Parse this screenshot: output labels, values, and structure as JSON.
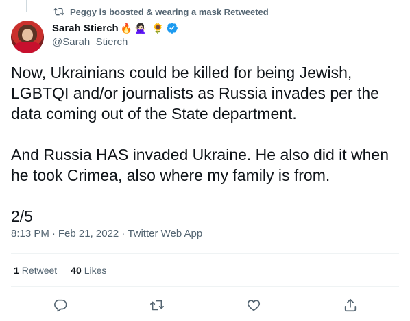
{
  "retweet_context": {
    "icon": "retweet-icon",
    "text": "Peggy is boosted & wearing a mask Retweeted"
  },
  "author": {
    "display_name": "Sarah Stierch",
    "emojis": [
      "🔥",
      "🙅🏻‍♀️",
      "🌻"
    ],
    "verified": true,
    "handle": "@Sarah_Stierch"
  },
  "tweet": {
    "text": "Now, Ukrainians could be killed for being Jewish, LGBTQI and/or journalists as Russia invades per the data coming out of the State department.\n\nAnd Russia HAS invaded Ukraine. He also did it when he took Crimea, also where my family is from.\n\n2/5"
  },
  "meta": {
    "time": "8:13 PM",
    "separator": "·",
    "date": "Feb 21, 2022",
    "source": "Twitter Web App"
  },
  "stats": {
    "retweets_count": "1",
    "retweets_label": "Retweet",
    "likes_count": "40",
    "likes_label": "Likes"
  },
  "actions": [
    "reply-icon",
    "retweet-icon",
    "like-icon",
    "share-icon"
  ],
  "colors": {
    "text_primary": "#0f1419",
    "text_secondary": "#536471",
    "verified_blue": "#1d9bf0",
    "divider": "#eff3f4"
  }
}
